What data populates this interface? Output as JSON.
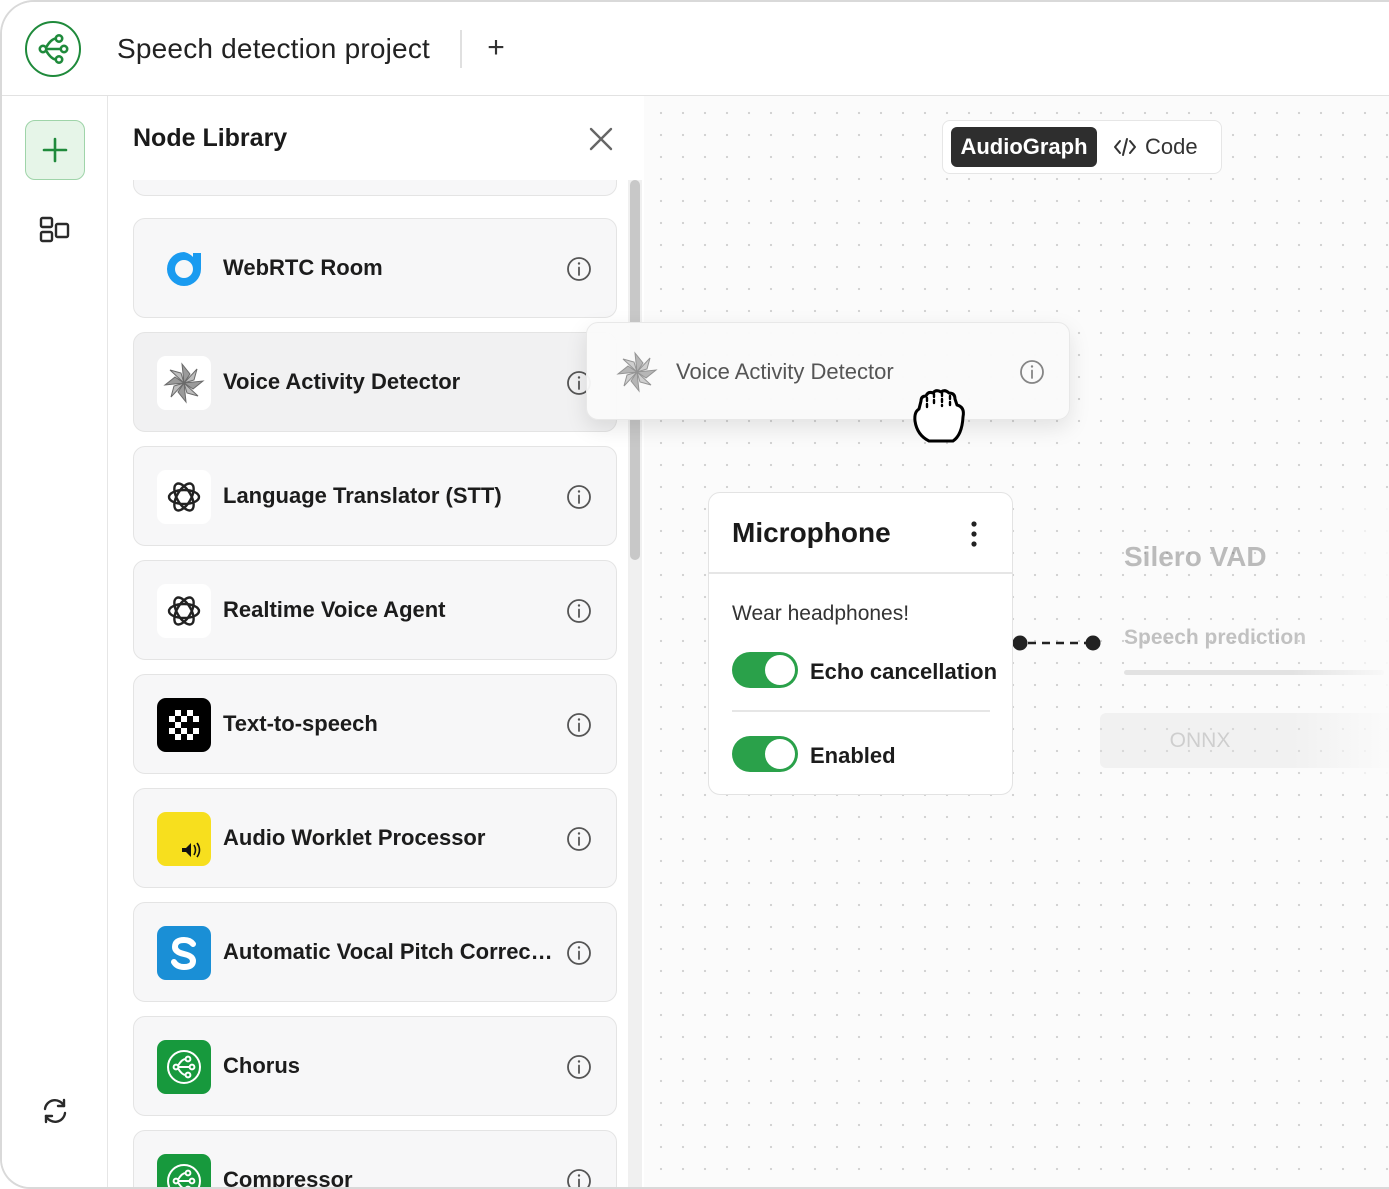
{
  "header": {
    "project_title": "Speech detection project",
    "add_tab_label": "+"
  },
  "library": {
    "title": "Node Library",
    "items": [
      {
        "label": "WebRTC Room",
        "icon": "webrtc-icon"
      },
      {
        "label": "Voice Activity Detector",
        "icon": "pinwheel-icon"
      },
      {
        "label": "Language Translator (STT)",
        "icon": "openai-icon"
      },
      {
        "label": "Realtime Voice Agent",
        "icon": "openai-icon"
      },
      {
        "label": "Text-to-speech",
        "icon": "tts-icon"
      },
      {
        "label": "Audio Worklet Processor",
        "icon": "speaker-icon"
      },
      {
        "label": "Automatic Vocal Pitch Correct...",
        "icon": "s-icon"
      },
      {
        "label": "Chorus",
        "icon": "audiograph-icon"
      },
      {
        "label": "Compressor",
        "icon": "audiograph-icon"
      }
    ]
  },
  "view_switcher": {
    "active": "AudioGraph",
    "code": "Code"
  },
  "dragged_node": {
    "label": "Voice Activity Detector"
  },
  "microphone_node": {
    "title": "Microphone",
    "note": "Wear headphones!",
    "toggles": [
      {
        "label": "Echo cancellation",
        "on": true
      },
      {
        "label": "Enabled",
        "on": true
      }
    ]
  },
  "silero_node": {
    "title": "Silero VAD",
    "output": "Speech prediction",
    "button": "ONNX"
  },
  "colors": {
    "brand_green": "#1f8a3b",
    "toggle_green": "#2aa14a",
    "dark": "#2e2e2e"
  }
}
